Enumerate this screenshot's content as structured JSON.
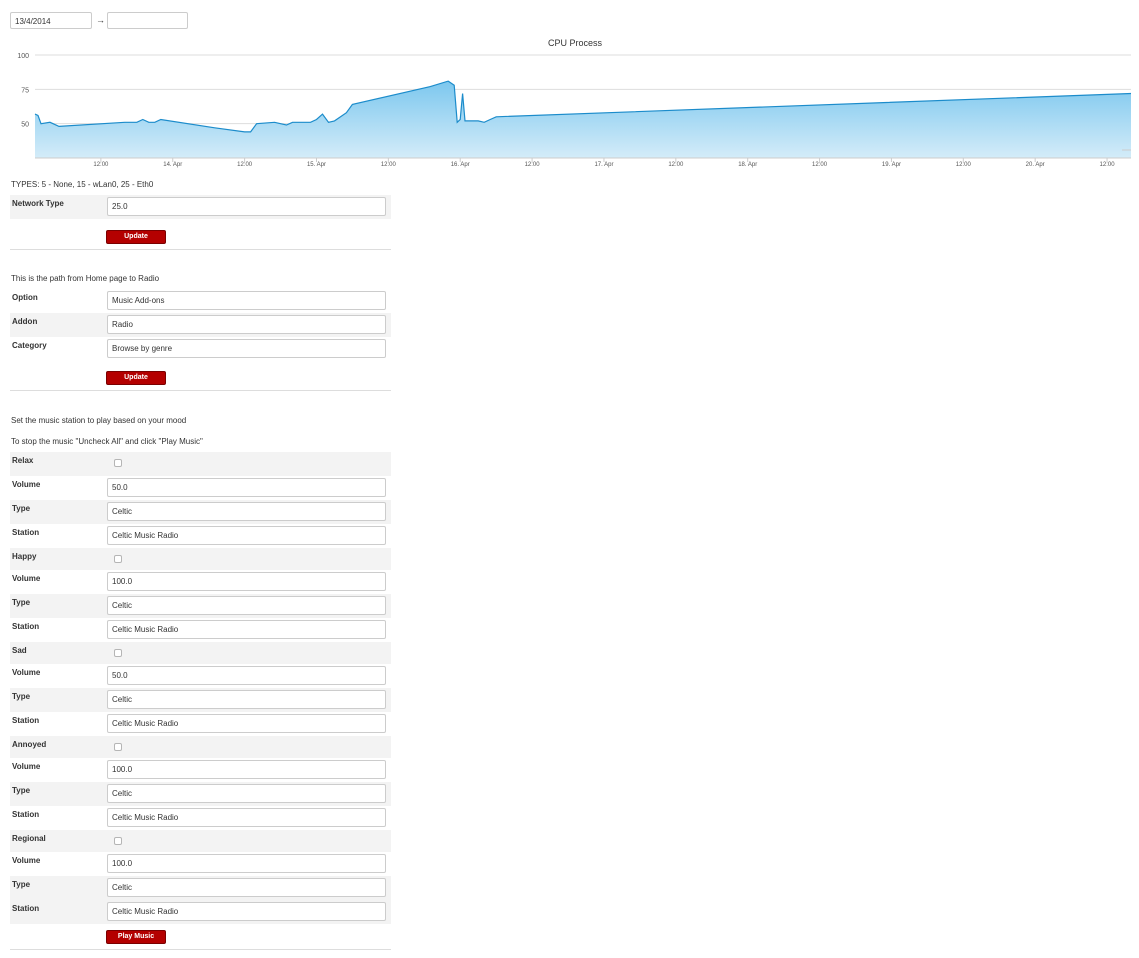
{
  "date_range": {
    "from": "13/4/2014",
    "to": "",
    "arrow": "→"
  },
  "chart_data": {
    "type": "area",
    "title": "CPU Process",
    "color": "#1c8ccb",
    "fill_top": "#7cc7ee",
    "fill_bottom": "#d4ecf9",
    "y_ticks": [
      50,
      75,
      100
    ],
    "ylim": [
      25,
      100
    ],
    "x_ticks": [
      "12:00",
      "14. Apr",
      "12:00",
      "15. Apr",
      "12:00",
      "16. Apr",
      "12:00",
      "17. Apr",
      "12:00",
      "18. Apr",
      "12:00",
      "19. Apr",
      "12:00",
      "20. Apr",
      "12:00"
    ],
    "x_tick_hours": [
      12,
      24,
      36,
      48,
      60,
      72,
      84,
      96,
      108,
      120,
      132,
      144,
      156,
      168,
      180
    ],
    "xlim_hours": [
      1,
      184
    ],
    "series": [
      {
        "points": [
          [
            1,
            57
          ],
          [
            1.5,
            56
          ],
          [
            2,
            50
          ],
          [
            3.5,
            51
          ],
          [
            5,
            48
          ],
          [
            16,
            51
          ],
          [
            17,
            51
          ],
          [
            18,
            51
          ],
          [
            19,
            53
          ],
          [
            20,
            51
          ],
          [
            21,
            51
          ],
          [
            22,
            53
          ],
          [
            31,
            47
          ],
          [
            36,
            44
          ],
          [
            37,
            44
          ],
          [
            38,
            50
          ],
          [
            41,
            51
          ],
          [
            42,
            50
          ],
          [
            43,
            49
          ],
          [
            44,
            51
          ],
          [
            46,
            51
          ],
          [
            47,
            51
          ],
          [
            48,
            53
          ],
          [
            49,
            57
          ],
          [
            50,
            51
          ],
          [
            51,
            52
          ],
          [
            53,
            58
          ],
          [
            54,
            64
          ],
          [
            67,
            77
          ],
          [
            70,
            81
          ],
          [
            71,
            78
          ],
          [
            71.5,
            51
          ],
          [
            72,
            53
          ],
          [
            72.4,
            72
          ],
          [
            72.8,
            52
          ],
          [
            73,
            52
          ],
          [
            75,
            52
          ],
          [
            76,
            51
          ],
          [
            77,
            53
          ],
          [
            78,
            55
          ],
          [
            184,
            72
          ]
        ]
      }
    ]
  },
  "network": {
    "types_caption": "TYPES: 5 - None, 15 - wLan0, 25 - Eth0",
    "label": "Network Type",
    "value": "25.0",
    "update_label": "Update"
  },
  "path": {
    "caption": "This is the path from Home page to Radio",
    "rows": [
      {
        "label": "Option",
        "value": "Music Add-ons"
      },
      {
        "label": "Addon",
        "value": "Radio"
      },
      {
        "label": "Category",
        "value": "Browse by genre"
      }
    ],
    "update_label": "Update"
  },
  "mood": {
    "caption1": "Set the music station to play based on your mood",
    "caption2": "To stop the music \"Uncheck All\" and click \"Play Music\"",
    "volume_label": "Volume",
    "type_label": "Type",
    "station_label": "Station",
    "moods": [
      {
        "name": "Relax",
        "checked": false,
        "volume": "50.0",
        "type": "Celtic",
        "station": "Celtic Music Radio"
      },
      {
        "name": "Happy",
        "checked": false,
        "volume": "100.0",
        "type": "Celtic",
        "station": "Celtic Music Radio"
      },
      {
        "name": "Sad",
        "checked": false,
        "volume": "50.0",
        "type": "Celtic",
        "station": "Celtic Music Radio"
      },
      {
        "name": "Annoyed",
        "checked": false,
        "volume": "100.0",
        "type": "Celtic",
        "station": "Celtic Music Radio"
      },
      {
        "name": "Regional",
        "checked": false,
        "volume": "100.0",
        "type": "Celtic",
        "station": "Celtic Music Radio"
      }
    ],
    "play_label": "Play Music"
  }
}
